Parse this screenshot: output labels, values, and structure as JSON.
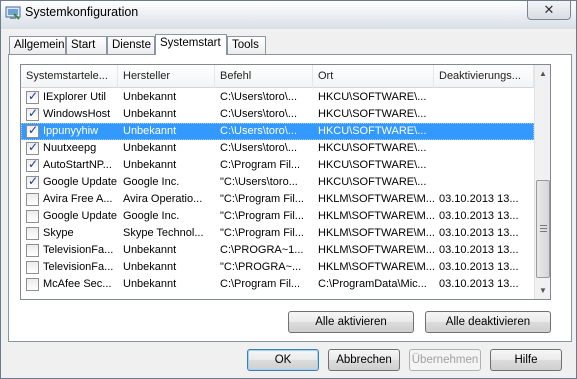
{
  "window": {
    "title": "Systemkonfiguration",
    "close_label": "✕"
  },
  "tabs": [
    {
      "label": "Allgemein",
      "active": false
    },
    {
      "label": "Start",
      "active": false
    },
    {
      "label": "Dienste",
      "active": false
    },
    {
      "label": "Systemstart",
      "active": true
    },
    {
      "label": "Tools",
      "active": false
    }
  ],
  "table": {
    "columns": [
      "Systemstartele...",
      "Hersteller",
      "Befehl",
      "Ort",
      "Deaktivierungs..."
    ],
    "rows": [
      {
        "checked": true,
        "item": "IExplorer Util",
        "maker": "Unbekannt",
        "command": "C:\\Users\\toro\\...",
        "location": "HKCU\\SOFTWARE\\...",
        "date": "",
        "selected": false
      },
      {
        "checked": true,
        "item": "WindowsHost",
        "maker": "Unbekannt",
        "command": "C:\\Users\\toro\\...",
        "location": "HKCU\\SOFTWARE\\...",
        "date": "",
        "selected": false
      },
      {
        "checked": true,
        "item": "Ippunyyhiw",
        "maker": "Unbekannt",
        "command": "C:\\Users\\toro\\...",
        "location": "HKCU\\SOFTWARE\\...",
        "date": "",
        "selected": true
      },
      {
        "checked": true,
        "item": "Nuutxeepg",
        "maker": "Unbekannt",
        "command": "C:\\Users\\toro\\...",
        "location": "HKCU\\SOFTWARE\\...",
        "date": "",
        "selected": false
      },
      {
        "checked": true,
        "item": "AutoStartNP...",
        "maker": "Unbekannt",
        "command": "C:\\Program Fil...",
        "location": "HKCU\\SOFTWARE\\...",
        "date": "",
        "selected": false
      },
      {
        "checked": true,
        "item": "Google Update",
        "maker": "Google Inc.",
        "command": "\"C:\\Users\\toro...",
        "location": "HKCU\\SOFTWARE\\...",
        "date": "",
        "selected": false
      },
      {
        "checked": false,
        "item": "Avira Free A...",
        "maker": "Avira Operatio...",
        "command": "\"C:\\Program Fil...",
        "location": "HKLM\\SOFTWARE\\M...",
        "date": "03.10.2013 13...",
        "selected": false
      },
      {
        "checked": false,
        "item": "Google Update",
        "maker": "Google Inc.",
        "command": "\"C:\\Program Fil...",
        "location": "HKLM\\SOFTWARE\\M...",
        "date": "03.10.2013 13...",
        "selected": false
      },
      {
        "checked": false,
        "item": "Skype",
        "maker": "Skype Technol...",
        "command": "\"C:\\Program Fil...",
        "location": "HKLM\\SOFTWARE\\M...",
        "date": "03.10.2013 13...",
        "selected": false
      },
      {
        "checked": false,
        "item": "TelevisionFa...",
        "maker": "Unbekannt",
        "command": "C:\\PROGRA~1...",
        "location": "HKLM\\SOFTWARE\\M...",
        "date": "03.10.2013 13...",
        "selected": false
      },
      {
        "checked": false,
        "item": "TelevisionFa...",
        "maker": "Unbekannt",
        "command": "\"C:\\PROGRA~...",
        "location": "HKLM\\SOFTWARE\\M...",
        "date": "03.10.2013 13...",
        "selected": false
      },
      {
        "checked": false,
        "item": "McAfee Sec...",
        "maker": "Unbekannt",
        "command": "C:\\Program Fil...",
        "location": "C:\\ProgramData\\Mic...",
        "date": "03.10.2013 13...",
        "selected": false
      }
    ]
  },
  "scrollbar": {
    "up": "▲",
    "down": "▼"
  },
  "buttons": {
    "enable_all": "Alle aktivieren",
    "disable_all": "Alle deaktivieren",
    "ok": "OK",
    "cancel": "Abbrechen",
    "apply": "Übernehmen",
    "help": "Hilfe"
  }
}
